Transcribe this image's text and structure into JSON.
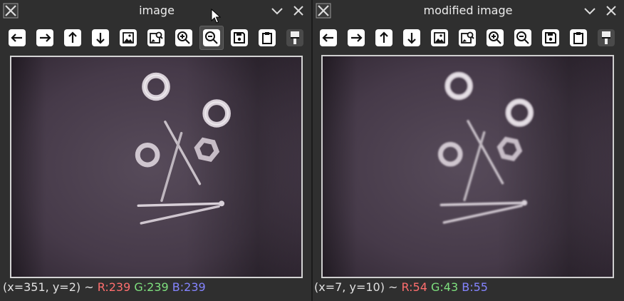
{
  "colors": {
    "r_label": "#ff6e6e",
    "g_label": "#7ee07e",
    "b_label": "#8484ff"
  },
  "windows": [
    {
      "title": "image",
      "status": {
        "coord": "(x=351, y=2) ~",
        "r": "R:239",
        "g": "G:239",
        "b": "B:239"
      },
      "active_tool": "zoom-out"
    },
    {
      "title": "modified image",
      "status": {
        "coord": "(x=7, y=10) ~",
        "r": "R:54",
        "g": "G:43",
        "b": "B:55"
      },
      "active_tool": ""
    }
  ],
  "toolbar_icons": [
    "arrow-left-icon",
    "arrow-right-icon",
    "arrow-up-icon",
    "arrow-down-icon",
    "image-icon",
    "zoom-image-icon",
    "zoom-in-icon",
    "zoom-out-icon",
    "save-icon",
    "clipboard-icon",
    "paintbrush-icon"
  ]
}
